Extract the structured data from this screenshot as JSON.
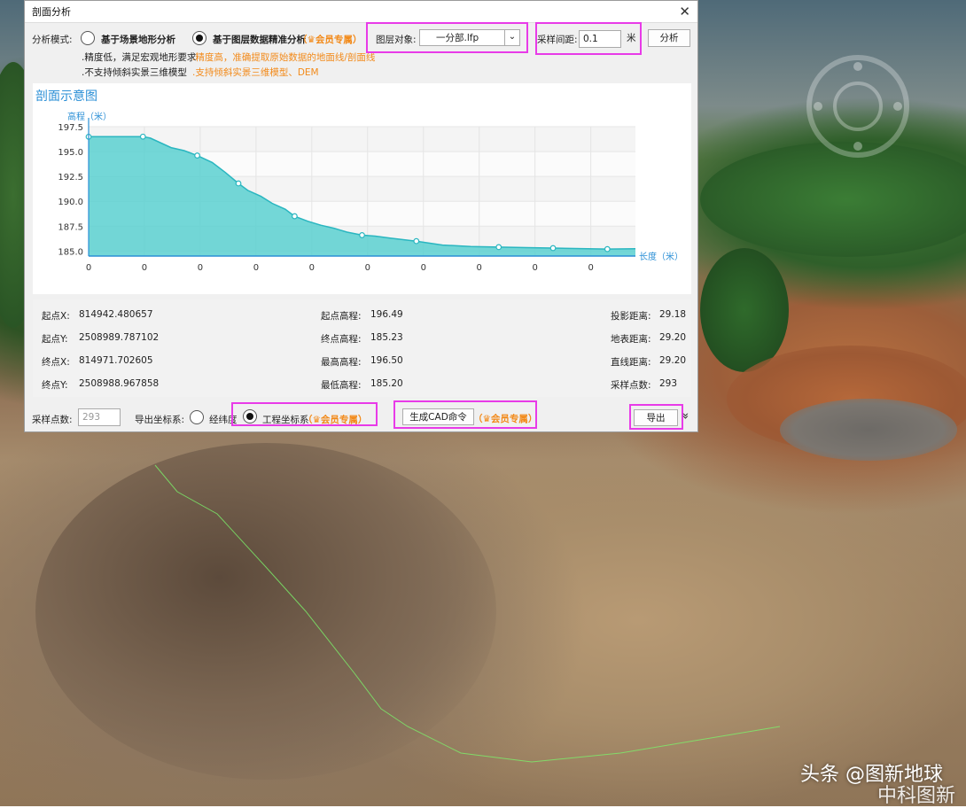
{
  "dialog": {
    "title": "剖面分析",
    "close_label": "✕"
  },
  "mode": {
    "label": "分析模式:",
    "option1_label": "基于场景地形分析",
    "option1_desc1": ".精度低，满足宏观地形要求",
    "option1_desc2": ".不支持倾斜实景三维模型",
    "option2_label": "基于图层数据精准分析",
    "option2_badge": "（♛会员专属）",
    "option2_desc1": ".精度高，准确提取原始数据的地面线/剖面线",
    "option2_desc2": ".支持倾斜实景三维模型、DEM",
    "selected": 2
  },
  "layer": {
    "label": "图层对象:",
    "value": "一分部.lfp"
  },
  "sampling": {
    "label": "采样间距:",
    "value": "0.1",
    "unit": "米"
  },
  "analyze_button": "分析",
  "chart_title": "剖面示意图",
  "chart_data": {
    "type": "area",
    "ylabel": "高程（米）",
    "xlabel": "长度（米）",
    "ylim": [
      184.5,
      197.5
    ],
    "xlim": [
      0,
      29.2
    ],
    "y_ticks": [
      197.5,
      195.0,
      192.5,
      190.0,
      187.5,
      185.0
    ],
    "y_tick_labels": [
      "197.5",
      "195.0",
      "192.5",
      "190.0",
      "187.5",
      "185.0"
    ],
    "x_tick_labels": [
      "0",
      "0",
      "0",
      "0",
      "0",
      "0",
      "0",
      "0",
      "0",
      "0"
    ],
    "x": [
      0,
      1.5,
      2.9,
      3.3,
      4.4,
      5.1,
      5.8,
      6.6,
      7.3,
      8.0,
      8.5,
      9.2,
      9.8,
      10.5,
      11.0,
      11.7,
      12.4,
      13.1,
      13.8,
      14.6,
      15.3,
      16.1,
      17.5,
      18.9,
      20.4,
      21.9,
      23.4,
      24.8,
      26.3,
      27.7,
      29.2
    ],
    "y": [
      196.49,
      196.5,
      196.5,
      196.35,
      195.4,
      195.1,
      194.6,
      193.9,
      192.9,
      191.8,
      191.1,
      190.5,
      189.8,
      189.2,
      188.5,
      188.0,
      187.6,
      187.3,
      186.9,
      186.6,
      186.5,
      186.3,
      186.0,
      185.6,
      185.45,
      185.4,
      185.35,
      185.3,
      185.25,
      185.2,
      185.23
    ],
    "marker_indices": [
      0,
      2,
      6,
      9,
      14,
      19,
      22,
      25,
      27,
      29
    ],
    "color": "#5bd0d0",
    "line_color": "#2ab6c0",
    "grid": true
  },
  "stats": {
    "start_x_label": "起点X:",
    "start_x": "814942.480657",
    "start_y_label": "起点Y:",
    "start_y": "2508989.787102",
    "end_x_label": "终点X:",
    "end_x": "814971.702605",
    "end_y_label": "终点Y:",
    "end_y": "2508988.967858",
    "start_h_label": "起点高程:",
    "start_h": "196.49",
    "end_h_label": "终点高程:",
    "end_h": "185.23",
    "max_h_label": "最高高程:",
    "max_h": "196.50",
    "min_h_label": "最低高程:",
    "min_h": "185.20",
    "proj_dist_label": "投影距离:",
    "proj_dist": "29.18",
    "surf_dist_label": "地表距离:",
    "surf_dist": "29.20",
    "line_dist_label": "直线距离:",
    "line_dist": "29.20",
    "samples_label": "采样点数:",
    "samples": "293"
  },
  "footer": {
    "samples_label": "采样点数:",
    "samples_value": "293",
    "coord_label": "导出坐标系:",
    "coord_opt1": "经纬度",
    "coord_opt2": "工程坐标系",
    "coord_badge": "（♛会员专属）",
    "cad_button": "生成CAD命令",
    "cad_badge": "（♛会员专属）",
    "export_button": "导出",
    "expand_icon": "»"
  },
  "watermark": {
    "line1": "头条 @图新地球",
    "line2": "中科图新"
  }
}
